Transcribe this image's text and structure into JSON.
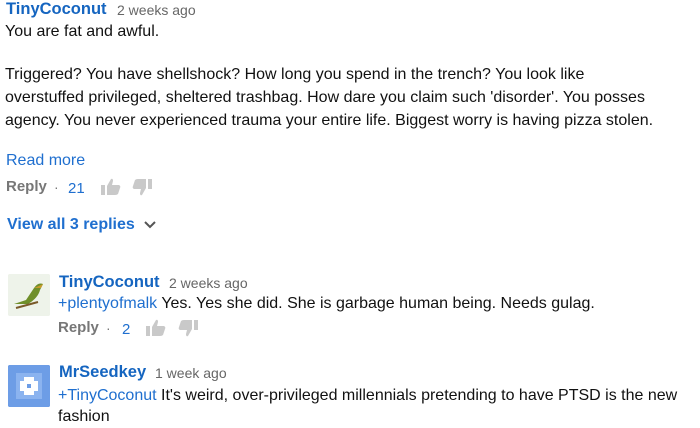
{
  "comment": {
    "author": "TinyCoconut",
    "time": "2 weeks ago",
    "line1": "You are fat and awful.",
    "paragraph": [
      "Triggered?  You have shellshock?  How long you spend in the trench?  You look like",
      "overstuffed privileged, sheltered trashbag.  How dare you claim such 'disorder'.  You posses",
      "agency.  You never experienced trauma your entire life.  Biggest worry is having pizza stolen."
    ],
    "read_more": "Read more",
    "reply": "Reply",
    "sep": "·",
    "likes": "21",
    "view_replies": "View all 3 replies"
  },
  "replies": [
    {
      "author": "TinyCoconut",
      "time": "2 weeks ago",
      "mention": "+plentyofmalk",
      "text": " Yes.  Yes she did.  She is garbage human being.  Needs gulag.",
      "reply": "Reply",
      "sep": "·",
      "likes": "2"
    },
    {
      "author": "MrSeedkey",
      "time": "1 week ago",
      "mention": "+TinyCoconut",
      "text": " It's weird, over-privileged millennials pretending to have PTSD is the new",
      "text2": "fashion"
    }
  ],
  "colors": {
    "link": "#1f6fcf",
    "author": "#1565c0",
    "muted": "#777777"
  }
}
